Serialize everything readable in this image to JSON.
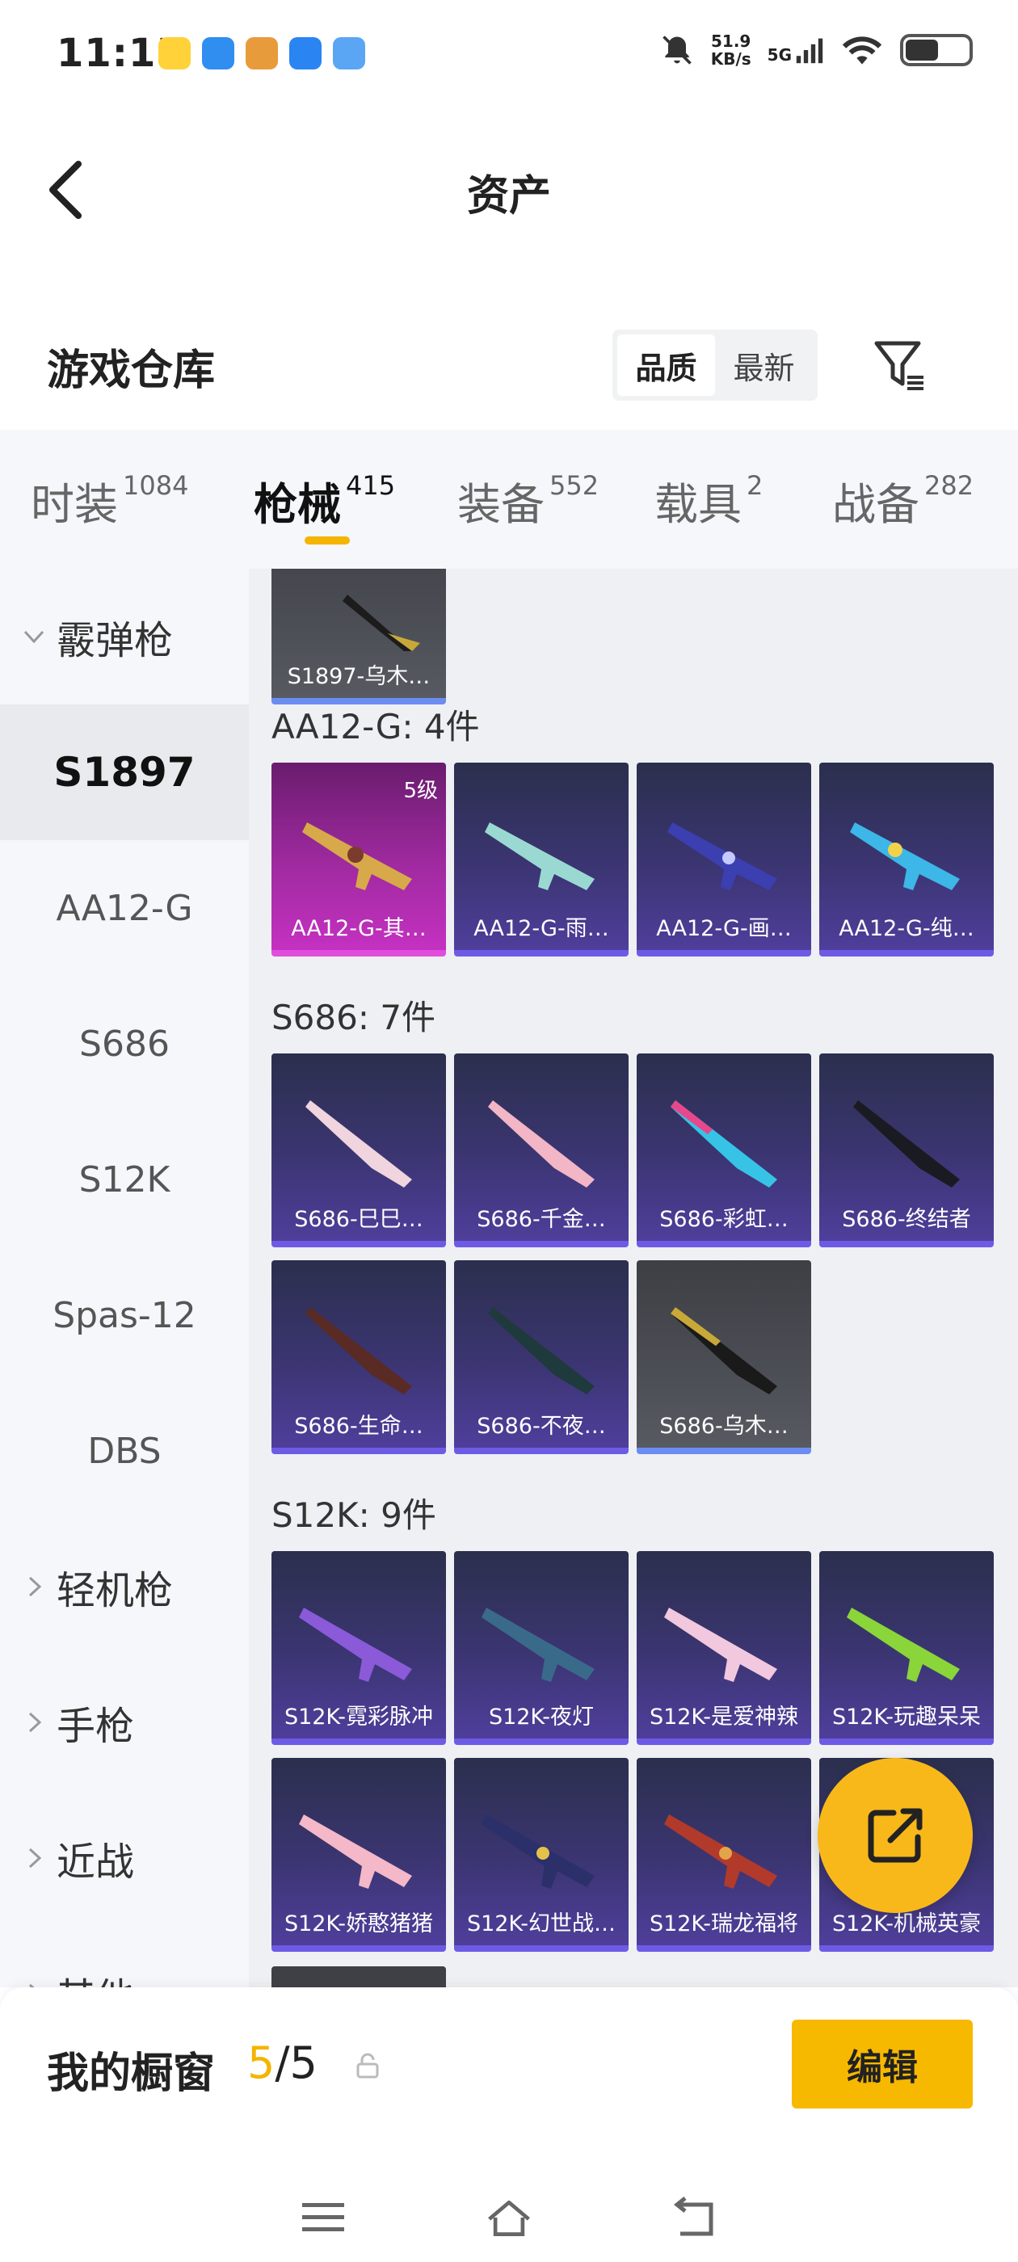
{
  "status": {
    "time": "11:15",
    "speed_value": "51.9",
    "speed_unit": "KB/s",
    "network": "5G"
  },
  "nav": {
    "title": "资产"
  },
  "warehouse": {
    "title": "游戏仓库",
    "sort": [
      {
        "label": "品质",
        "active": true
      },
      {
        "label": "最新",
        "active": false
      }
    ]
  },
  "tabs": [
    {
      "label": "时装",
      "count": "1084"
    },
    {
      "label": "枪械",
      "count": "415",
      "active": true
    },
    {
      "label": "装备",
      "count": "552"
    },
    {
      "label": "载具",
      "count": "2"
    },
    {
      "label": "战备",
      "count": "282"
    }
  ],
  "sidenav": {
    "group_shotgun": "霰弹枪",
    "items": [
      "S1897",
      "AA12-G",
      "S686",
      "S12K",
      "Spas-12",
      "DBS"
    ],
    "group_lmg": "轻机枪",
    "group_pistol": "手枪",
    "group_melee": "近战",
    "group_other": "其他"
  },
  "groups": [
    {
      "title": "AA12-G: 4件"
    },
    {
      "title": "S686: 7件"
    },
    {
      "title": "S12K: 9件"
    }
  ],
  "cards": {
    "s1897_0": {
      "name": "S1897-乌木…"
    },
    "aa12_0": {
      "name": "AA12-G-其…",
      "level": "5级"
    },
    "aa12_1": {
      "name": "AA12-G-雨…"
    },
    "aa12_2": {
      "name": "AA12-G-画…"
    },
    "aa12_3": {
      "name": "AA12-G-纯…"
    },
    "s686_0": {
      "name": "S686-巳巳…"
    },
    "s686_1": {
      "name": "S686-千金…"
    },
    "s686_2": {
      "name": "S686-彩虹…"
    },
    "s686_3": {
      "name": "S686-终结者"
    },
    "s686_4": {
      "name": "S686-生命…"
    },
    "s686_5": {
      "name": "S686-不夜…"
    },
    "s686_6": {
      "name": "S686-乌木…"
    },
    "s12k_0": {
      "name": "S12K-霓彩脉冲"
    },
    "s12k_1": {
      "name": "S12K-夜灯"
    },
    "s12k_2": {
      "name": "S12K-是爱神辣"
    },
    "s12k_3": {
      "name": "S12K-玩趣呆呆"
    },
    "s12k_4": {
      "name": "S12K-娇憨猪猪"
    },
    "s12k_5": {
      "name": "S12K-幻世战…"
    },
    "s12k_6": {
      "name": "S12K-瑞龙福将"
    },
    "s12k_7": {
      "name": "S12K-机械英豪"
    }
  },
  "showcase": {
    "label": "我的橱窗",
    "current": "5",
    "sep_total": "/5",
    "edit": "编辑"
  },
  "colors": {
    "accent": "#f5b400",
    "card_purple": "#4f3e9b",
    "card_pink": "#c431c1",
    "card_gray": "#4c4e55"
  }
}
